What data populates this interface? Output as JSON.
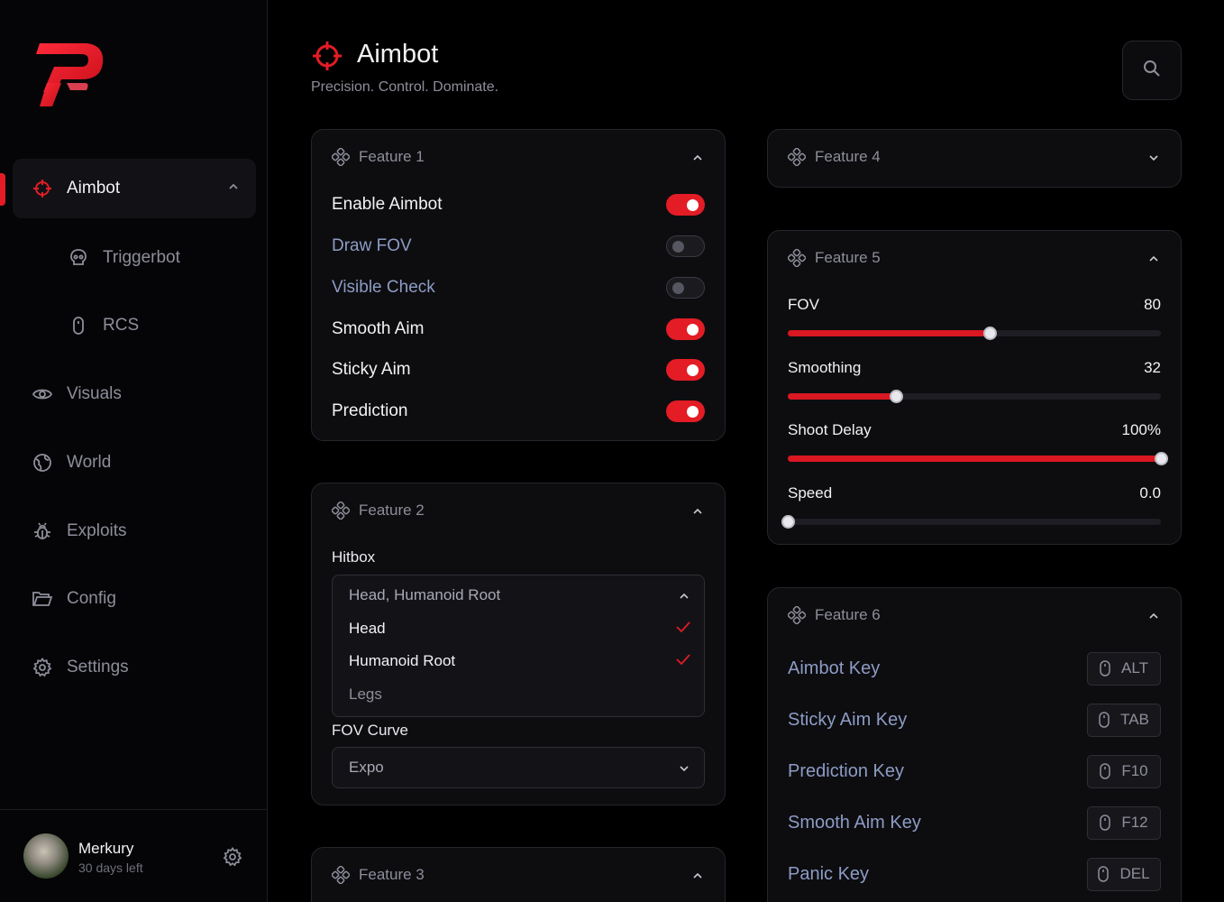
{
  "sidebar": {
    "items": [
      {
        "label": "Aimbot",
        "icon": "crosshair-icon"
      },
      {
        "label": "Triggerbot",
        "icon": "skull-icon"
      },
      {
        "label": "RCS",
        "icon": "mouse-icon"
      },
      {
        "label": "Visuals",
        "icon": "eye-icon"
      },
      {
        "label": "World",
        "icon": "globe-icon"
      },
      {
        "label": "Exploits",
        "icon": "bug-icon"
      },
      {
        "label": "Config",
        "icon": "folder-icon"
      },
      {
        "label": "Settings",
        "icon": "gear-icon"
      }
    ],
    "profile": {
      "name": "Merkury",
      "subtitle": "30 days left"
    }
  },
  "header": {
    "title": "Aimbot",
    "subtitle": "Precision. Control. Dominate."
  },
  "colors": {
    "accent": "#e31c25",
    "background": "#000000",
    "card": "#0d0d10"
  },
  "feature1": {
    "title": "Feature 1",
    "toggles": [
      {
        "label": "Enable Aimbot",
        "on": true
      },
      {
        "label": "Draw FOV",
        "on": false
      },
      {
        "label": "Visible Check",
        "on": false
      },
      {
        "label": "Smooth Aim",
        "on": true
      },
      {
        "label": "Sticky Aim",
        "on": true
      },
      {
        "label": "Prediction",
        "on": true
      }
    ]
  },
  "feature2": {
    "title": "Feature 2",
    "hitbox_label": "Hitbox",
    "hitbox_value": "Head, Humanoid Root",
    "hitbox_options": [
      {
        "label": "Head",
        "selected": true
      },
      {
        "label": "Humanoid Root",
        "selected": true
      },
      {
        "label": "Legs",
        "selected": false
      }
    ],
    "fov_curve_label": "FOV Curve",
    "fov_curve_value": "Expo"
  },
  "feature3": {
    "title": "Feature 3"
  },
  "feature4": {
    "title": "Feature 4"
  },
  "feature5": {
    "title": "Feature 5",
    "sliders": [
      {
        "label": "FOV",
        "value": "80",
        "fraction": 0.54
      },
      {
        "label": "Smoothing",
        "value": "32",
        "fraction": 0.29
      },
      {
        "label": "Shoot Delay",
        "value": "100%",
        "fraction": 1.0
      },
      {
        "label": "Speed",
        "value": "0.0",
        "fraction": 0.0
      }
    ]
  },
  "feature6": {
    "title": "Feature 6",
    "keys": [
      {
        "label": "Aimbot Key",
        "key": "ALT"
      },
      {
        "label": "Sticky Aim Key",
        "key": "TAB"
      },
      {
        "label": "Prediction Key",
        "key": "F10"
      },
      {
        "label": "Smooth Aim Key",
        "key": "F12"
      },
      {
        "label": "Panic Key",
        "key": "DEL"
      }
    ]
  }
}
